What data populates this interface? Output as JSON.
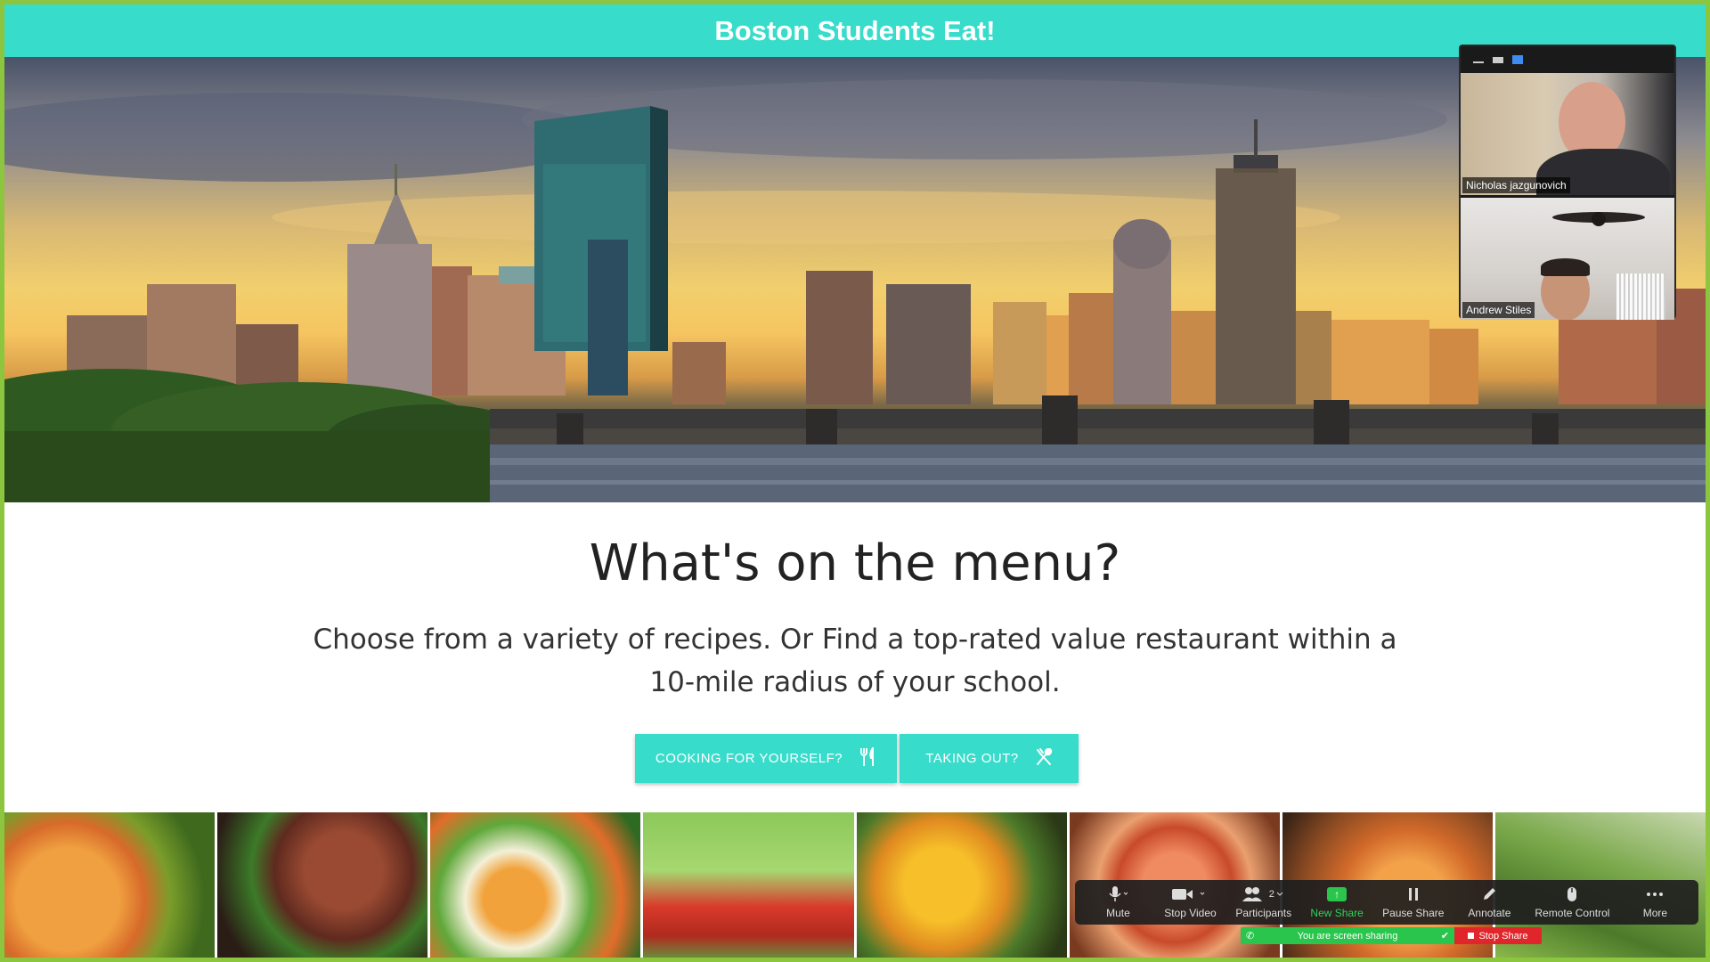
{
  "site": {
    "title": "Boston Students Eat!"
  },
  "hero": {
    "image_name": "boston-skyline-image"
  },
  "main": {
    "heading": "What's on the menu?",
    "description": "Choose from a variety of recipes. Or Find a top-rated value restaurant within a 10-mile radius of your school.",
    "buttons": [
      {
        "label": "COOKING FOR YOURSELF?",
        "icon": "utensils-icon"
      },
      {
        "label": "TAKING OUT?",
        "icon": "fork-spoon-cross-icon"
      }
    ]
  },
  "zoom": {
    "participants": [
      {
        "name": "Nicholas jazgunovich"
      },
      {
        "name": "Andrew Stiles"
      }
    ],
    "toolbar": {
      "mute": "Mute",
      "stop_video": "Stop Video",
      "participants": "Participants",
      "participant_count": "2",
      "new_share": "New Share",
      "pause_share": "Pause Share",
      "annotate": "Annotate",
      "remote_control": "Remote Control",
      "more": "More"
    },
    "sharing_status": "You are screen sharing",
    "stop_share": "Stop Share"
  },
  "colors": {
    "accent": "#38dccb",
    "share_border": "#8cc63f",
    "zoom_green": "#29c54c",
    "zoom_red": "#e0262b"
  }
}
